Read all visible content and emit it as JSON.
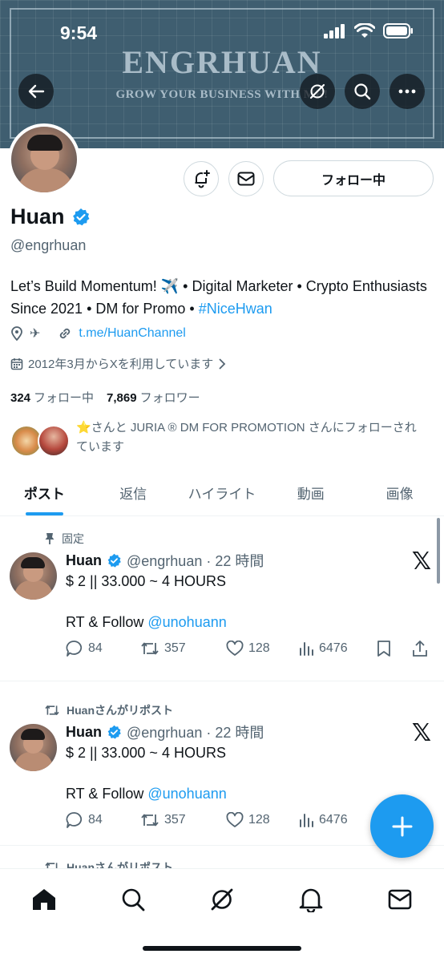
{
  "status_bar": {
    "time": "9:54"
  },
  "banner": {
    "title": "ENGRHUAN",
    "subtitle": "GROW YOUR BUSINESS WITH ME!"
  },
  "profile": {
    "follow_label": "フォロー中",
    "name": "Huan",
    "handle": "@engrhuan",
    "bio_part1": "Let’s Build Momentum! ✈️ • Digital Marketer • Crypto Enthusiasts Since 2021 • DM for Promo • ",
    "bio_hashtag": "#NiceHwan",
    "location_emoji": "✈",
    "link": "t.me/HuanChannel",
    "joined": "2012年3月からXを利用しています",
    "following_count": "324",
    "following_label": "フォロー中",
    "followers_count": "7,869",
    "followers_label": "フォロワー",
    "followed_by": "⭐さんと JURIA ® DM FOR PROMOTION さんにフォローされています"
  },
  "tabs": [
    "ポスト",
    "返信",
    "ハイライト",
    "動画",
    "画像"
  ],
  "posts": [
    {
      "context": "固定",
      "name": "Huan",
      "handle_time": "@engrhuan · 22 時間",
      "line1": "$ 2 || 33.000 ~ 4 HOURS",
      "line2_prefix": "RT & Follow ",
      "mention": "@unohuann",
      "replies": "84",
      "reposts": "357",
      "likes": "128",
      "views": "6476"
    },
    {
      "context": "Huanさんがリポスト",
      "name": "Huan",
      "handle_time": "@engrhuan · 22 時間",
      "line1": "$ 2 || 33.000 ~ 4 HOURS",
      "line2_prefix": "RT & Follow ",
      "mention": "@unohuann",
      "replies": "84",
      "reposts": "357",
      "likes": "128",
      "views": "6476"
    }
  ],
  "partial_context": "Huanさんがリポスト",
  "x_logo": "𝕏",
  "colors": {
    "accent": "#1d9bf0",
    "text": "#0f1419",
    "muted": "#536471",
    "banner": "#3f5e70"
  },
  "icons": [
    "back-arrow-icon",
    "grok-icon",
    "search-icon",
    "more-icon",
    "bell-add-icon",
    "mail-icon",
    "verified-badge-icon",
    "location-icon",
    "link-icon",
    "calendar-icon",
    "pin-icon",
    "repost-icon",
    "reply-icon",
    "like-icon",
    "views-icon",
    "bookmark-icon",
    "share-icon",
    "plus-icon",
    "home-icon",
    "notifications-icon"
  ]
}
